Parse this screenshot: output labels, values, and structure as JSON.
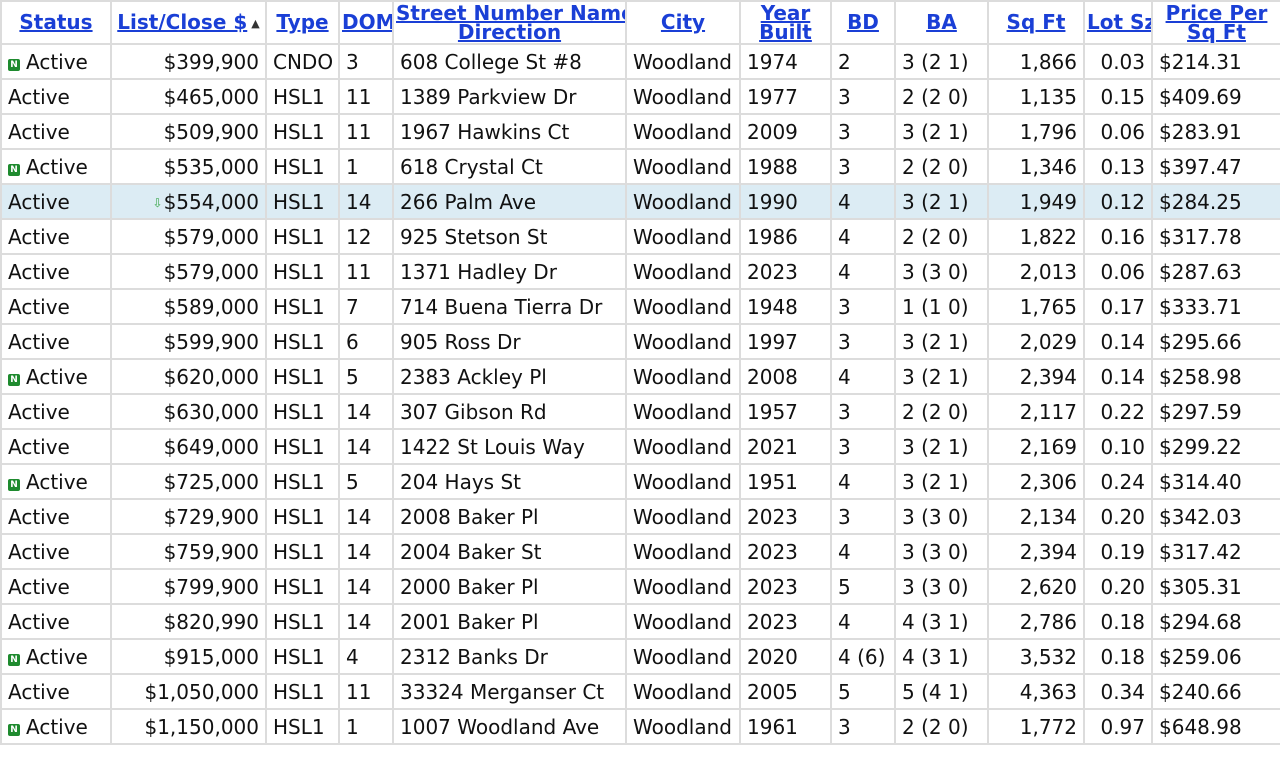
{
  "table": {
    "headers": {
      "status": "Status",
      "price": "List/Close $",
      "type": "Type",
      "dom": "DOM",
      "address_line1": "Street Number Name",
      "address_line2": "Direction",
      "city": "City",
      "year_line1": "Year",
      "year_line2": "Built",
      "bd": "BD",
      "ba": "BA",
      "sqft": "Sq Ft",
      "lot": "Lot Sz",
      "ppsf_line1": "Price Per",
      "ppsf_line2": "Sq Ft"
    },
    "sort": {
      "column": "price",
      "direction": "ascending"
    },
    "colors": {
      "link": "#1a3fd6",
      "status": "#1e8a2e",
      "highlight": "#dcecf4",
      "border": "#dcdcdc"
    },
    "rows": [
      {
        "is_new": true,
        "price_drop": false,
        "status": "Active",
        "price": "$399,900",
        "type": "CNDO",
        "dom": "3",
        "address": "608 College St #8",
        "city": "Woodland",
        "year": "1974",
        "bd": "2",
        "ba": "3 (2 1)",
        "sqft": "1,866",
        "lot": "0.03",
        "ppsf": "$214.31"
      },
      {
        "is_new": false,
        "price_drop": false,
        "status": "Active",
        "price": "$465,000",
        "type": "HSL1",
        "dom": "11",
        "address": "1389 Parkview Dr",
        "city": "Woodland",
        "year": "1977",
        "bd": "3",
        "ba": "2 (2 0)",
        "sqft": "1,135",
        "lot": "0.15",
        "ppsf": "$409.69"
      },
      {
        "is_new": false,
        "price_drop": false,
        "status": "Active",
        "price": "$509,900",
        "type": "HSL1",
        "dom": "11",
        "address": "1967 Hawkins Ct",
        "city": "Woodland",
        "year": "2009",
        "bd": "3",
        "ba": "3 (2 1)",
        "sqft": "1,796",
        "lot": "0.06",
        "ppsf": "$283.91"
      },
      {
        "is_new": true,
        "price_drop": false,
        "status": "Active",
        "price": "$535,000",
        "type": "HSL1",
        "dom": "1",
        "address": "618 Crystal Ct",
        "city": "Woodland",
        "year": "1988",
        "bd": "3",
        "ba": "2 (2 0)",
        "sqft": "1,346",
        "lot": "0.13",
        "ppsf": "$397.47"
      },
      {
        "is_new": false,
        "price_drop": true,
        "status": "Active",
        "price": "$554,000",
        "type": "HSL1",
        "dom": "14",
        "address": "266 Palm Ave",
        "city": "Woodland",
        "year": "1990",
        "bd": "4",
        "ba": "3 (2 1)",
        "sqft": "1,949",
        "lot": "0.12",
        "ppsf": "$284.25"
      },
      {
        "is_new": false,
        "price_drop": false,
        "status": "Active",
        "price": "$579,000",
        "type": "HSL1",
        "dom": "12",
        "address": "925 Stetson St",
        "city": "Woodland",
        "year": "1986",
        "bd": "4",
        "ba": "2 (2 0)",
        "sqft": "1,822",
        "lot": "0.16",
        "ppsf": "$317.78"
      },
      {
        "is_new": false,
        "price_drop": false,
        "status": "Active",
        "price": "$579,000",
        "type": "HSL1",
        "dom": "11",
        "address": "1371 Hadley Dr",
        "city": "Woodland",
        "year": "2023",
        "bd": "4",
        "ba": "3 (3 0)",
        "sqft": "2,013",
        "lot": "0.06",
        "ppsf": "$287.63"
      },
      {
        "is_new": false,
        "price_drop": false,
        "status": "Active",
        "price": "$589,000",
        "type": "HSL1",
        "dom": "7",
        "address": "714 Buena Tierra Dr",
        "city": "Woodland",
        "year": "1948",
        "bd": "3",
        "ba": "1 (1 0)",
        "sqft": "1,765",
        "lot": "0.17",
        "ppsf": "$333.71"
      },
      {
        "is_new": false,
        "price_drop": false,
        "status": "Active",
        "price": "$599,900",
        "type": "HSL1",
        "dom": "6",
        "address": "905 Ross Dr",
        "city": "Woodland",
        "year": "1997",
        "bd": "3",
        "ba": "3 (2 1)",
        "sqft": "2,029",
        "lot": "0.14",
        "ppsf": "$295.66"
      },
      {
        "is_new": true,
        "price_drop": false,
        "status": "Active",
        "price": "$620,000",
        "type": "HSL1",
        "dom": "5",
        "address": "2383 Ackley Pl",
        "city": "Woodland",
        "year": "2008",
        "bd": "4",
        "ba": "3 (2 1)",
        "sqft": "2,394",
        "lot": "0.14",
        "ppsf": "$258.98"
      },
      {
        "is_new": false,
        "price_drop": false,
        "status": "Active",
        "price": "$630,000",
        "type": "HSL1",
        "dom": "14",
        "address": "307 Gibson Rd",
        "city": "Woodland",
        "year": "1957",
        "bd": "3",
        "ba": "2 (2 0)",
        "sqft": "2,117",
        "lot": "0.22",
        "ppsf": "$297.59"
      },
      {
        "is_new": false,
        "price_drop": false,
        "status": "Active",
        "price": "$649,000",
        "type": "HSL1",
        "dom": "14",
        "address": "1422 St Louis Way",
        "city": "Woodland",
        "year": "2021",
        "bd": "3",
        "ba": "3 (2 1)",
        "sqft": "2,169",
        "lot": "0.10",
        "ppsf": "$299.22"
      },
      {
        "is_new": true,
        "price_drop": false,
        "status": "Active",
        "price": "$725,000",
        "type": "HSL1",
        "dom": "5",
        "address": "204 Hays St",
        "city": "Woodland",
        "year": "1951",
        "bd": "4",
        "ba": "3 (2 1)",
        "sqft": "2,306",
        "lot": "0.24",
        "ppsf": "$314.40"
      },
      {
        "is_new": false,
        "price_drop": false,
        "status": "Active",
        "price": "$729,900",
        "type": "HSL1",
        "dom": "14",
        "address": "2008 Baker Pl",
        "city": "Woodland",
        "year": "2023",
        "bd": "3",
        "ba": "3 (3 0)",
        "sqft": "2,134",
        "lot": "0.20",
        "ppsf": "$342.03"
      },
      {
        "is_new": false,
        "price_drop": false,
        "status": "Active",
        "price": "$759,900",
        "type": "HSL1",
        "dom": "14",
        "address": "2004 Baker St",
        "city": "Woodland",
        "year": "2023",
        "bd": "4",
        "ba": "3 (3 0)",
        "sqft": "2,394",
        "lot": "0.19",
        "ppsf": "$317.42"
      },
      {
        "is_new": false,
        "price_drop": false,
        "status": "Active",
        "price": "$799,900",
        "type": "HSL1",
        "dom": "14",
        "address": "2000 Baker Pl",
        "city": "Woodland",
        "year": "2023",
        "bd": "5",
        "ba": "3 (3 0)",
        "sqft": "2,620",
        "lot": "0.20",
        "ppsf": "$305.31"
      },
      {
        "is_new": false,
        "price_drop": false,
        "status": "Active",
        "price": "$820,990",
        "type": "HSL1",
        "dom": "14",
        "address": "2001 Baker Pl",
        "city": "Woodland",
        "year": "2023",
        "bd": "4",
        "ba": "4 (3 1)",
        "sqft": "2,786",
        "lot": "0.18",
        "ppsf": "$294.68"
      },
      {
        "is_new": true,
        "price_drop": false,
        "status": "Active",
        "price": "$915,000",
        "type": "HSL1",
        "dom": "4",
        "address": "2312 Banks Dr",
        "city": "Woodland",
        "year": "2020",
        "bd": "4 (6)",
        "ba": "4 (3 1)",
        "sqft": "3,532",
        "lot": "0.18",
        "ppsf": "$259.06"
      },
      {
        "is_new": false,
        "price_drop": false,
        "status": "Active",
        "price": "$1,050,000",
        "type": "HSL1",
        "dom": "11",
        "address": "33324 Merganser Ct",
        "city": "Woodland",
        "year": "2005",
        "bd": "5",
        "ba": "5 (4 1)",
        "sqft": "4,363",
        "lot": "0.34",
        "ppsf": "$240.66"
      },
      {
        "is_new": true,
        "price_drop": false,
        "status": "Active",
        "price": "$1,150,000",
        "type": "HSL1",
        "dom": "1",
        "address": "1007 Woodland Ave",
        "city": "Woodland",
        "year": "1961",
        "bd": "3",
        "ba": "2 (2 0)",
        "sqft": "1,772",
        "lot": "0.97",
        "ppsf": "$648.98"
      }
    ]
  }
}
